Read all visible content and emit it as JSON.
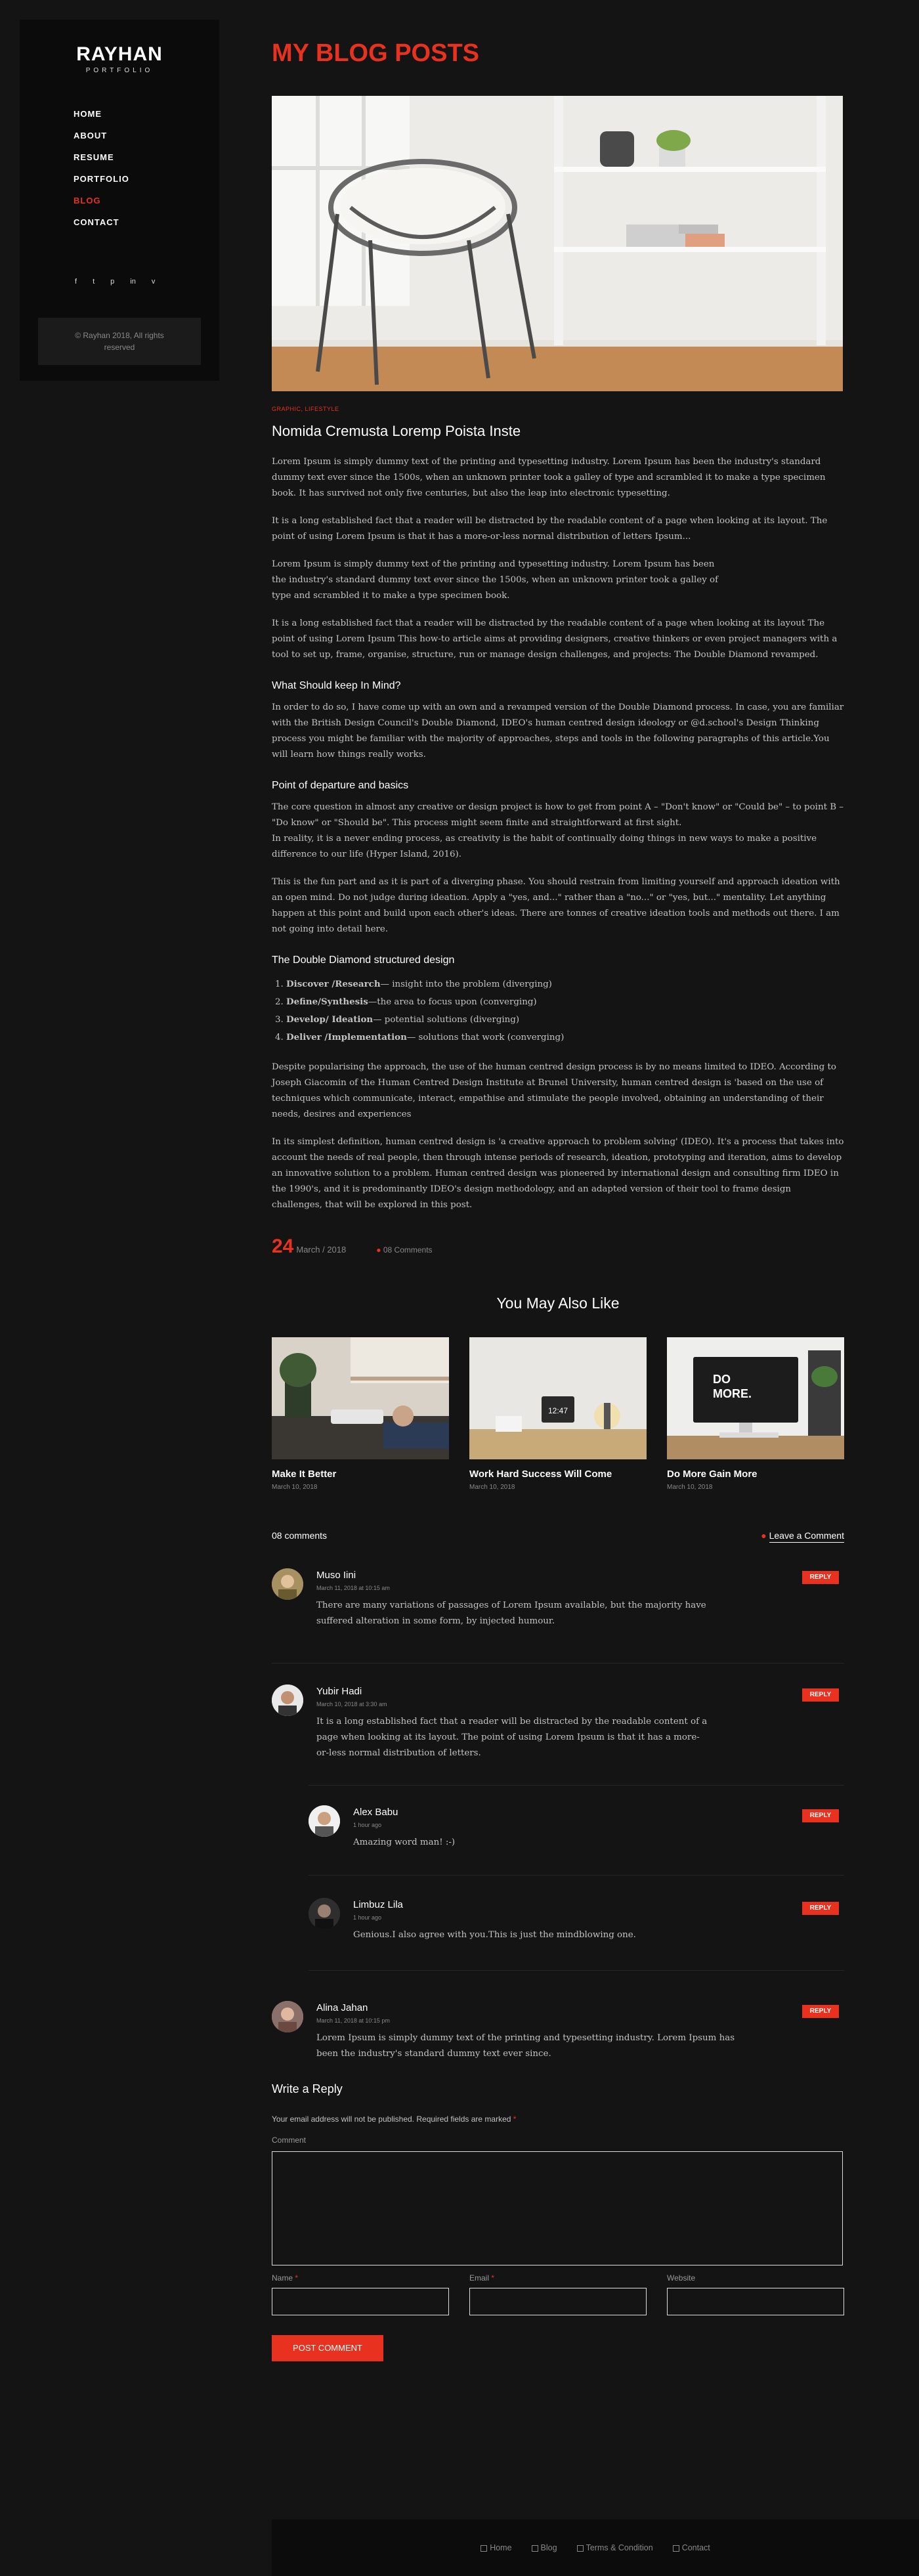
{
  "sidebar": {
    "logo_name": "RAYHAN",
    "logo_sub": "PORTFOLIO",
    "nav": [
      "HOME",
      "ABOUT",
      "RESUME",
      "PORTFOLIO",
      "BLOG",
      "CONTACT"
    ],
    "active_item": "BLOG",
    "social": [
      "f",
      "t",
      "p",
      "in",
      "v"
    ],
    "social_icons": [
      "facebook-icon",
      "twitter-icon",
      "pinterest-icon",
      "linkedin-icon",
      "vimeo-icon"
    ],
    "copyright_1": "© Rayhan 2018, All rights",
    "copyright_2": "reserved"
  },
  "page": {
    "title": "MY BLOG POSTS",
    "accent_color": "#e8321f"
  },
  "post": {
    "category": "GRAPHIC, LIFESTYLE",
    "title": "Nomida Cremusta Loremp Poista Inste",
    "p1": "Lorem Ipsum is simply dummy text of the printing and typesetting industry. Lorem Ipsum has been the industry's standard dummy text ever since the 1500s, when an unknown printer took a galley of type and scrambled it to make a type specimen book. It has survived not only five centuries, but also the leap into electronic typesetting.",
    "p2": "It is a long established fact that a reader will be distracted by the readable content of a page when looking at its layout. The point of using Lorem Ipsum is that it has a more-or-less normal distribution of letters Ipsum...",
    "p3": "Lorem Ipsum is simply dummy text of the printing and typesetting industry. Lorem Ipsum has been the industry's standard dummy text ever since the 1500s, when an unknown printer took a galley of type and scrambled it to make a type specimen book.",
    "p4": "It is a long established fact that a reader will be distracted by the readable content of a page when looking at its layout The point of using Lorem Ipsum This how-to article aims at providing designers, creative thinkers or even project managers with a tool to set up, frame, organise, structure, run or manage design challenges, and projects: The Double Diamond revamped.",
    "h1": "What Should keep In Mind?",
    "p5": "In order to do so, I have come up with an own and a revamped version of the Double Diamond process. In case, you are familiar with the British Design Council's Double Diamond, IDEO's human centred design ideology or @d.school's Design Thinking process you might be familiar with the majority of approaches, steps and tools in the following paragraphs of this article.You will learn how things really works.",
    "h2": "Point of departure and basics",
    "p6": "The core question in almost any creative or design project is how to get from point A – \"Don't know\" or \"Could be\" – to point B – \"Do know\" or \"Should be\". This process might seem finite and straightforward at first sight.",
    "p6b": "In reality, it is a never ending process, as creativity is the habit of continually doing things in new ways to make a positive difference to our life (Hyper Island, 2016).",
    "p7": "This is the fun part and as it is part of a diverging phase. You should restrain from limiting yourself and approach ideation with an open mind. Do not judge during ideation. Apply a \"yes, and...\" rather than a \"no...\" or \"yes, but...\" mentality. Let anything happen at this point and build upon each other's ideas. There are tonnes of creative ideation tools and methods out there. I am not going into detail here.",
    "h3": "The Double Diamond  structured design",
    "steps": [
      {
        "bold": "Discover /Research",
        "rest": "— insight into the problem (diverging)"
      },
      {
        "bold": "Define/Synthesis",
        "rest": "—the area to focus upon (converging)"
      },
      {
        "bold": "Develop/ Ideation",
        "rest": "— potential solutions (diverging)"
      },
      {
        "bold": "Deliver /Implementation",
        "rest": "— solutions that work (converging)"
      }
    ],
    "p8": "Despite popularising the approach, the use of the human centred design process is by no means limited to IDEO. According to Joseph Giacomin of the Human Centred Design Institute at Brunel University, human centred design is 'based on the use of techniques which communicate, interact, empathise and stimulate the people involved, obtaining an understanding of their needs, desires and experiences",
    "p9": "In its simplest definition, human centred design is 'a creative approach to problem solving' (IDEO). It's a process that takes into account the needs of real people, then through intense periods of research, ideation, prototyping and iteration, aims to develop an innovative solution to a problem. Human centred design was pioneered by international design and consulting firm IDEO in the 1990's, and it is predominantly IDEO's design methodology, and an adapted version of their tool to frame design challenges, that will be explored in this post.",
    "day": "24",
    "month_year": "March / 2018",
    "comments_count": "08 Comments"
  },
  "related": {
    "heading": "You May Also Like",
    "items": [
      {
        "title": "Make It Better",
        "date": "March 10, 2018"
      },
      {
        "title": "Work Hard Success Will Come",
        "date": "March 10, 2018"
      },
      {
        "title": "Do More Gain More",
        "date": "March 10, 2018"
      }
    ],
    "clock_text": "12:47",
    "screen_text_1": "DO",
    "screen_text_2": "MORE."
  },
  "comments": {
    "count_label": "08 comments",
    "leave_label": "Leave a Comment",
    "reply_label": "REPLY",
    "items": [
      {
        "name": "Muso Iini",
        "date": "March 11, 2018 at 10:15 am",
        "text": "There are many variations of passages of Lorem Ipsum available, but the majority have suffered alteration in some form, by injected humour."
      },
      {
        "name": "Yubir Hadi",
        "date": "March 10, 2018 at 3:30 am",
        "text": "It is a long established fact that a reader will be distracted by the readable content of a page when looking at its layout. The point of using Lorem Ipsum is that it has a more-or-less normal distribution of letters."
      },
      {
        "name": "Alex Babu",
        "date": "1 hour ago",
        "text": "Amazing word man! :-)"
      },
      {
        "name": "Limbuz Lila",
        "date": "1 hour ago",
        "text": "Genious.I also agree with you.This is just the mindblowing one."
      },
      {
        "name": "Alina Jahan",
        "date": "March 11, 2018 at 10:15 pm",
        "text": "Lorem Ipsum is simply dummy text of the printing and typesetting industry. Lorem Ipsum has been the industry's standard dummy text ever since."
      }
    ]
  },
  "reply_form": {
    "heading": "Write a Reply",
    "note": "Your email address will not be published. Required fields are marked",
    "required_mark": "*",
    "comment_label": "Comment",
    "name_label": "Name",
    "email_label": "Email",
    "website_label": "Website",
    "submit_label": "POST COMMENT"
  },
  "footer": {
    "links": [
      "Home",
      "Blog",
      "Terms & Condition",
      "Contact"
    ]
  }
}
